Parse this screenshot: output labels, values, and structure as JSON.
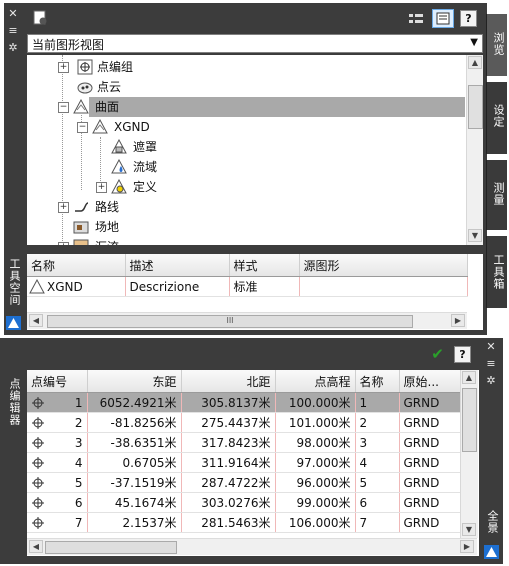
{
  "toolspace": {
    "side_title": "工具空间",
    "dropdown_value": "当前图形视图",
    "tabs": [
      "浏览",
      "设定",
      "测量",
      "工具箱"
    ],
    "tree": [
      {
        "label": "点编组",
        "icon": "point-group-icon",
        "expander": "+"
      },
      {
        "label": "点云",
        "icon": "point-cloud-icon",
        "expander": ""
      },
      {
        "label": "曲面",
        "icon": "surface-icon",
        "expander": "−",
        "selected": true
      },
      {
        "label": "XGND",
        "icon": "surface-icon",
        "expander": "−"
      },
      {
        "label": "遮罩",
        "icon": "mask-icon",
        "expander": ""
      },
      {
        "label": "流域",
        "icon": "watershed-icon",
        "expander": ""
      },
      {
        "label": "定义",
        "icon": "definition-icon",
        "expander": "+"
      },
      {
        "label": "路线",
        "icon": "alignment-icon",
        "expander": "+"
      },
      {
        "label": "场地",
        "icon": "site-icon",
        "expander": ""
      },
      {
        "label": "汇流",
        "icon": "catchment-icon",
        "expander": "+"
      }
    ],
    "list": {
      "headers": [
        "名称",
        "描述",
        "样式",
        "源图形"
      ],
      "rows": [
        {
          "name": "XGND",
          "desc": "Descrizione",
          "style": "标准",
          "source": ""
        }
      ]
    },
    "hscroll_grip": "III"
  },
  "point_editor": {
    "side_title": "点编辑器",
    "right_tab": "全景",
    "headers": [
      "点编号",
      "东距",
      "北距",
      "点高程",
      "名称",
      "原始..."
    ],
    "rows": [
      {
        "num": "1",
        "east": "6052.4921米",
        "north": "305.8137米",
        "elev": "100.000米",
        "name": "1",
        "orig": "GRND"
      },
      {
        "num": "2",
        "east": "-81.8256米",
        "north": "275.4437米",
        "elev": "101.000米",
        "name": "2",
        "orig": "GRND"
      },
      {
        "num": "3",
        "east": "-38.6351米",
        "north": "317.8423米",
        "elev": "98.000米",
        "name": "3",
        "orig": "GRND"
      },
      {
        "num": "4",
        "east": "0.6705米",
        "north": "311.9164米",
        "elev": "97.000米",
        "name": "4",
        "orig": "GRND"
      },
      {
        "num": "5",
        "east": "-37.1519米",
        "north": "287.4722米",
        "elev": "96.000米",
        "name": "5",
        "orig": "GRND"
      },
      {
        "num": "6",
        "east": "45.1674米",
        "north": "303.0276米",
        "elev": "99.000米",
        "name": "6",
        "orig": "GRND"
      },
      {
        "num": "7",
        "east": "2.1537米",
        "north": "281.5463米",
        "elev": "106.000米",
        "name": "7",
        "orig": "GRND"
      }
    ],
    "help_label": "?",
    "check_label": "✔"
  },
  "colors": {
    "frame": "#3c3c3c",
    "selected": "#a9a9a9",
    "accent": "#1d6fd1"
  }
}
